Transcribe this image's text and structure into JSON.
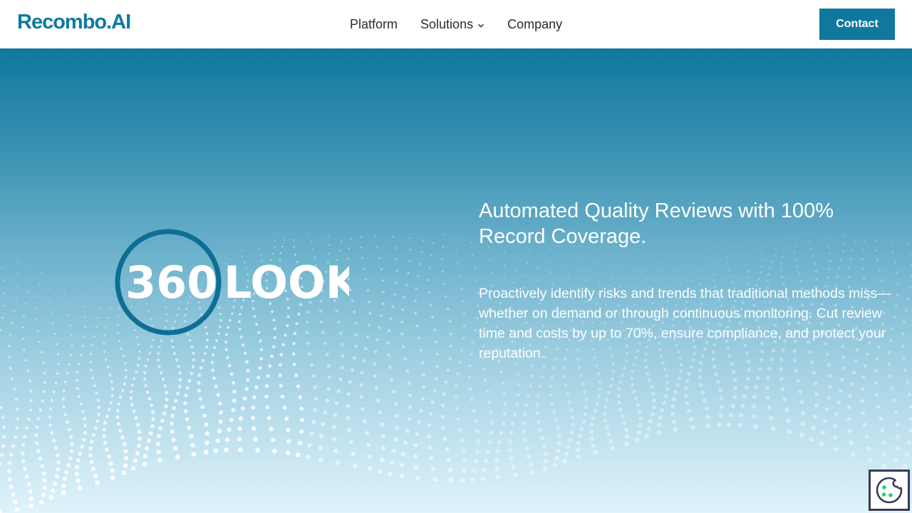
{
  "header": {
    "logo_text": "Recombo.AI",
    "nav": [
      {
        "label": "Platform"
      },
      {
        "label": "Solutions",
        "has_dropdown": true
      },
      {
        "label": "Company"
      }
    ],
    "contact_label": "Contact"
  },
  "hero": {
    "product_logo": {
      "number": "360",
      "word": "LOOK"
    },
    "headline": "Automated Quality Reviews with 100% Record Coverage.",
    "body": "Proactively identify risks and trends that traditional methods miss—whether on demand or through continuous monitoring. Cut review time and costs by up to 70%, ensure compliance, and protect your reputation."
  },
  "icons": {
    "chevron": "chevron-down-icon",
    "cookie": "cookie-icon"
  },
  "colors": {
    "brand": "#10789e",
    "nav_text": "#2b2b2b",
    "hero_top": "#10789e",
    "hero_bottom": "#dff3fb",
    "cookie_dots": "#2ecc71",
    "cookie_outline": "#3b3b55"
  }
}
